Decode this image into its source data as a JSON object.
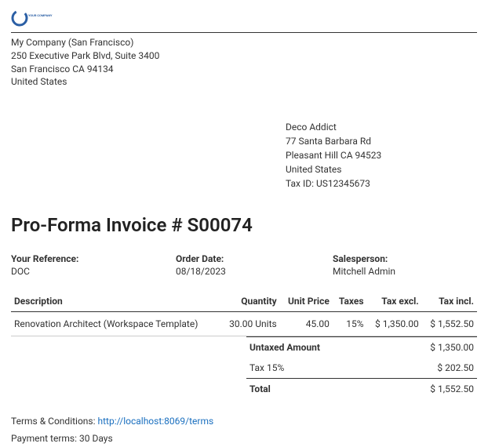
{
  "logo_text": "YOUR COMPANY",
  "company": {
    "name": "My Company (San Francisco)",
    "street": "250 Executive Park Blvd, Suite 3400",
    "city": "San Francisco CA 94134",
    "country": "United States"
  },
  "customer": {
    "name": "Deco Addict",
    "street": "77 Santa Barbara Rd",
    "city": "Pleasant Hill CA 94523",
    "country": "United States",
    "tax_id_label": "Tax ID: US12345673"
  },
  "title": "Pro-Forma Invoice # S00074",
  "meta": {
    "ref_label": "Your Reference:",
    "ref_value": "DOC",
    "date_label": "Order Date:",
    "date_value": "08/18/2023",
    "sales_label": "Salesperson:",
    "sales_value": "Mitchell Admin"
  },
  "columns": {
    "description": "Description",
    "quantity": "Quantity",
    "unit_price": "Unit Price",
    "taxes": "Taxes",
    "tax_excl": "Tax excl.",
    "tax_incl": "Tax incl."
  },
  "lines": [
    {
      "description": "Renovation Architect (Workspace Template)",
      "quantity": "30.00 Units",
      "unit_price": "45.00",
      "taxes": "15%",
      "tax_excl": "$ 1,350.00",
      "tax_incl": "$ 1,552.50"
    }
  ],
  "totals": {
    "untaxed_label": "Untaxed Amount",
    "untaxed_value": "$ 1,350.00",
    "tax_label": "Tax 15%",
    "tax_value": "$ 202.50",
    "total_label": "Total",
    "total_value": "$ 1,552.50"
  },
  "terms": {
    "conditions_label": "Terms & Conditions: ",
    "conditions_url": "http://localhost:8069/terms",
    "payment": "Payment terms: 30 Days"
  }
}
